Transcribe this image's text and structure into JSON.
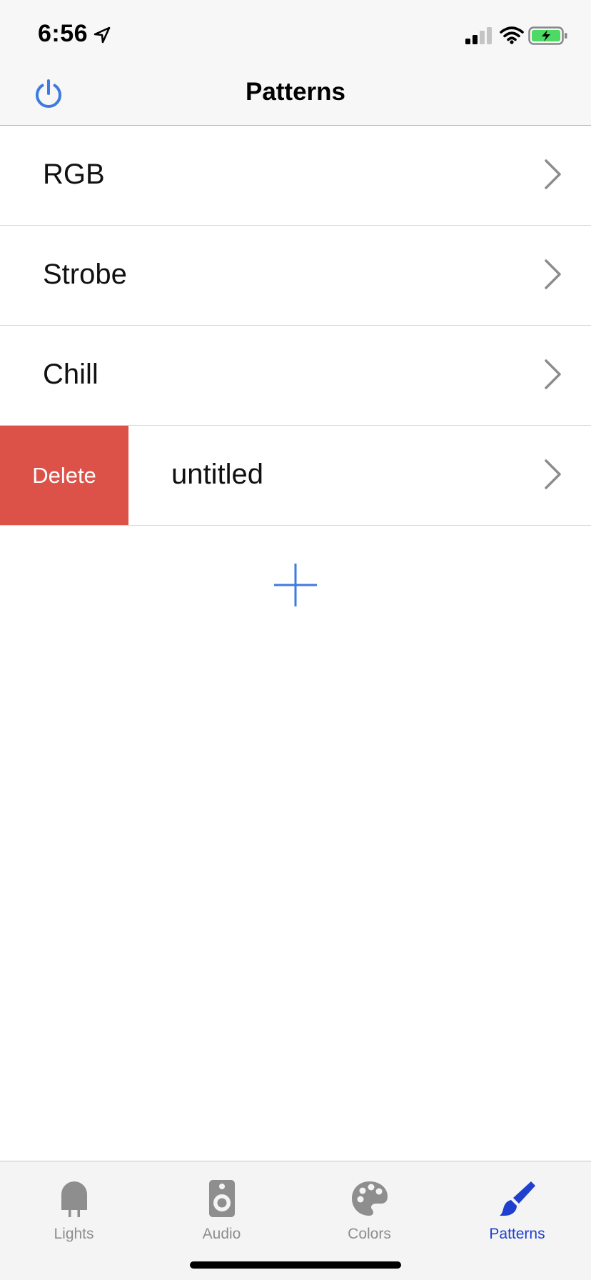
{
  "status_bar": {
    "time": "6:56"
  },
  "nav": {
    "title": "Patterns",
    "power_icon": "power-icon"
  },
  "list": {
    "rows": [
      {
        "label": "RGB"
      },
      {
        "label": "Strobe"
      },
      {
        "label": "Chill"
      },
      {
        "label": "untitled",
        "action_label": "Delete"
      }
    ],
    "add_icon": "plus-icon"
  },
  "tabs": [
    {
      "label": "Lights",
      "icon": "bulb-icon",
      "active": false
    },
    {
      "label": "Audio",
      "icon": "speaker-icon",
      "active": false
    },
    {
      "label": "Colors",
      "icon": "palette-icon",
      "active": false
    },
    {
      "label": "Patterns",
      "icon": "brush-icon",
      "active": true
    }
  ],
  "colors": {
    "accent": "#3d7be0",
    "active_tab": "#1f3fce",
    "delete": "#dc5249",
    "inactive_tab": "#8e8e8e",
    "battery": "#4cd964"
  }
}
